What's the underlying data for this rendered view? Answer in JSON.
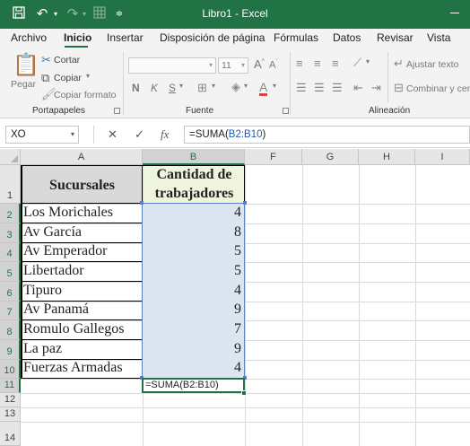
{
  "titlebar": {
    "title": "Libro1  -  Excel",
    "icons": [
      "save-icon",
      "undo-icon",
      "redo-icon",
      "table-icon",
      "customize-icon"
    ]
  },
  "tabs": [
    "Archivo",
    "Inicio",
    "Insertar",
    "Disposición de página",
    "Fórmulas",
    "Datos",
    "Revisar",
    "Vista"
  ],
  "ribbon": {
    "clipboard": {
      "paste": "Pegar",
      "cut": "Cortar",
      "copy": "Copiar",
      "format_painter": "Copiar formato",
      "label": "Portapapeles"
    },
    "font": {
      "name": "",
      "size": "11",
      "bold": "N",
      "italic": "K",
      "underline": "S",
      "label": "Fuente"
    },
    "alignment": {
      "wrap_text": "Ajustar texto",
      "merge": "Combinar y cen",
      "label": "Alineación"
    }
  },
  "formula_bar": {
    "name_box": "XO",
    "cancel": "✕",
    "enter": "✓",
    "fx": "fx",
    "formula_prefix": "=SUMA(",
    "formula_ref": "B2:B10",
    "formula_suffix": ")"
  },
  "grid": {
    "columns": [
      "A",
      "B",
      "F",
      "G",
      "H",
      "I"
    ],
    "rows": [
      "1",
      "2",
      "3",
      "4",
      "5",
      "6",
      "7",
      "8",
      "9",
      "10",
      "11",
      "12",
      "13",
      "14"
    ],
    "header_a": "Sucursales",
    "header_b_line1": "Cantidad de",
    "header_b_line2": "trabajadores",
    "data": [
      {
        "name": "Los Morichales",
        "value": "4"
      },
      {
        "name": "Av García",
        "value": "8"
      },
      {
        "name": "Av Emperador",
        "value": "5"
      },
      {
        "name": "Libertador",
        "value": "5"
      },
      {
        "name": "Tipuro",
        "value": "4"
      },
      {
        "name": "Av Panamá",
        "value": "9"
      },
      {
        "name": "Romulo Gallegos",
        "value": "7"
      },
      {
        "name": "La paz",
        "value": "9"
      },
      {
        "name": "Fuerzas Armadas",
        "value": "4"
      }
    ],
    "active_cell_text": "=SUMA(B2:B10)"
  },
  "colors": {
    "excel_green": "#217346",
    "selection_fill": "#dce6f1",
    "header_fill": "#eef4de",
    "formula_ref": "#1f5fb4"
  }
}
